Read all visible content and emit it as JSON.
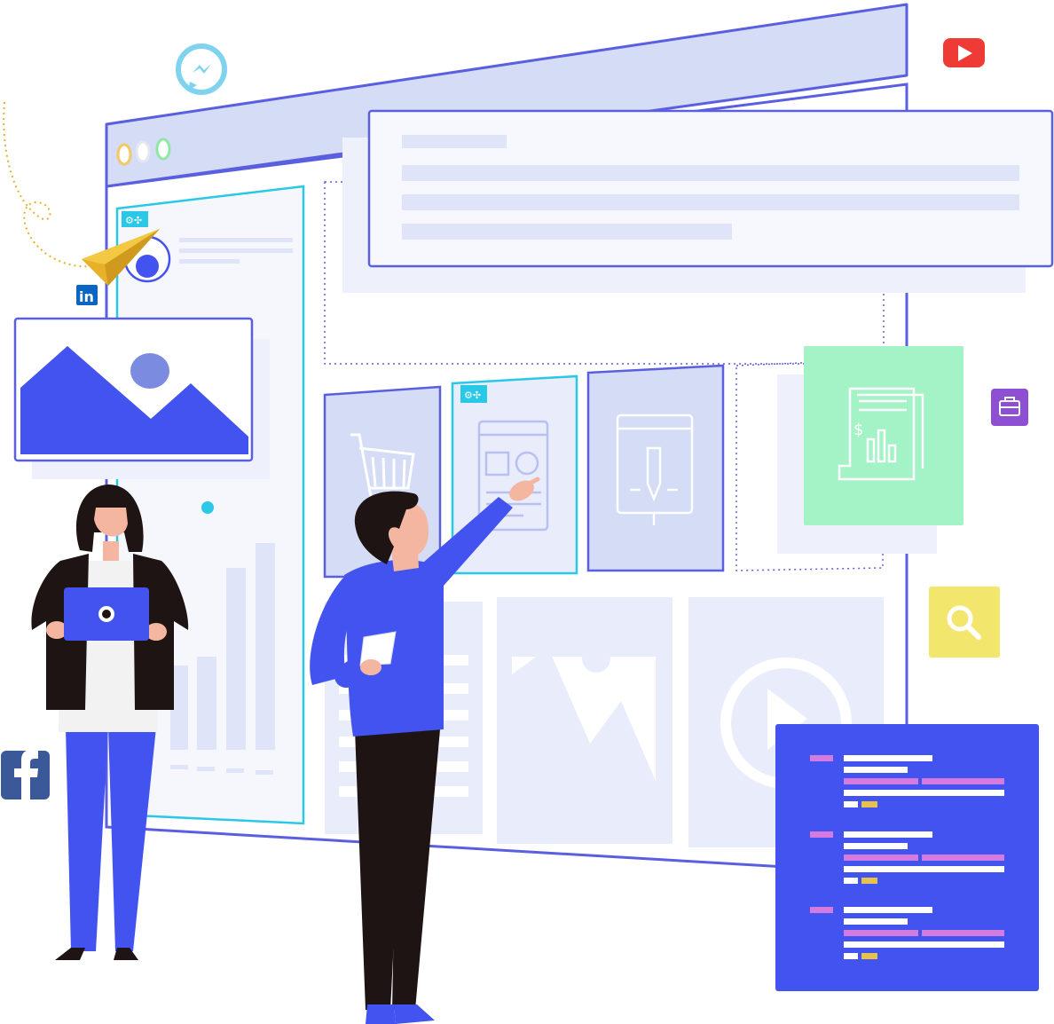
{
  "illustration": {
    "kind": "web-builder-hero-illustration",
    "window_controls": [
      "close",
      "minimize",
      "maximize"
    ],
    "social_icons": [
      "messenger-icon",
      "youtube-icon",
      "linkedin-icon",
      "facebook-icon"
    ],
    "widget_icons": [
      "cart-icon",
      "layout-icon",
      "design-pen-icon",
      "report-icon",
      "briefcase-icon",
      "search-icon",
      "image-icon",
      "play-icon"
    ],
    "colors": {
      "primary": "#4353f0",
      "outline": "#5a5fe0",
      "frame_light": "#d4dcf6",
      "panel_light": "#e9edfb",
      "cyan": "#29c8e6",
      "green_card": "#a3f3c6",
      "yellow_card": "#f3e66d",
      "purple_badge": "#8e4fd3",
      "youtube_red": "#ef3b36",
      "facebook_blue": "#3b5998",
      "linkedin_blue": "#0a66c2",
      "messenger_cyan": "#7fd3ef",
      "paper_plane": "#e7b22a",
      "code_pink": "#d57be0",
      "code_yellow": "#e6c24b",
      "dark": "#1e1413"
    }
  }
}
